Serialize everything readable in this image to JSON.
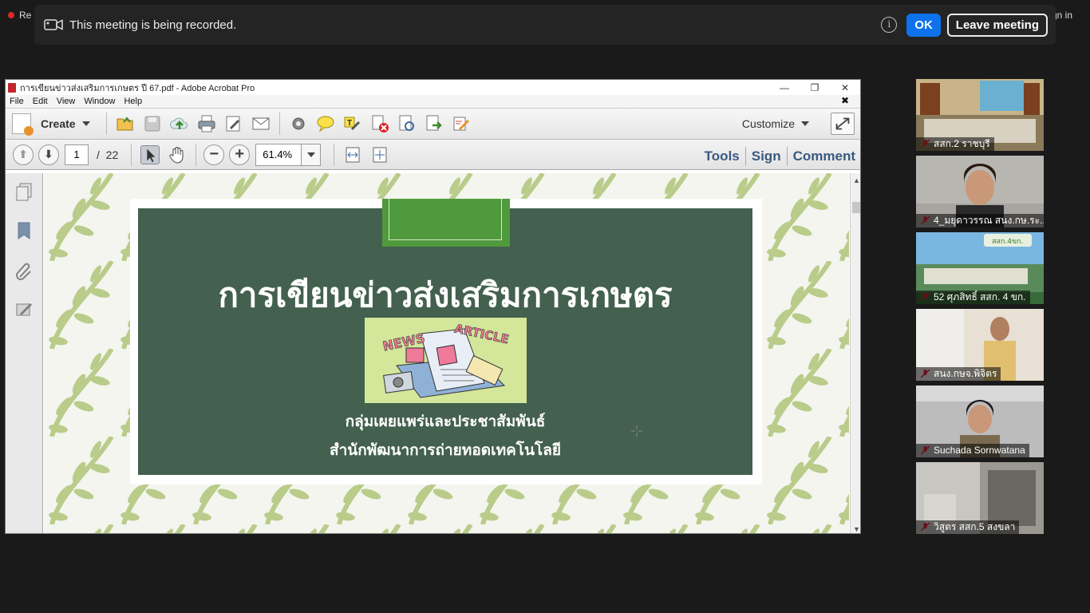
{
  "zoom": {
    "recording_indicator": "Re",
    "sign_in_partial": "gn in",
    "banner": {
      "message": "This meeting is being recorded.",
      "ok_label": "OK",
      "leave_label": "Leave meeting",
      "info_symbol": "i"
    }
  },
  "acrobat": {
    "window_title": "การเขียนข่าวส่งเสริมการเกษตร ปี 67.pdf - Adobe Acrobat Pro",
    "window_controls": {
      "minimize": "—",
      "restore": "❐",
      "close": "✕"
    },
    "menu": [
      "File",
      "Edit",
      "View",
      "Window",
      "Help"
    ],
    "menu_close": "✖",
    "toolbar": {
      "create_label": "Create",
      "customize_label": "Customize",
      "icons": [
        "open-folder-icon",
        "save-icon",
        "upload-cloud-icon",
        "print-icon",
        "edit-document-icon",
        "email-icon",
        "settings-gear-icon",
        "comment-bubble-icon",
        "highlight-text-icon",
        "delete-page-icon",
        "find-page-icon",
        "export-icon",
        "sign-pen-icon"
      ]
    },
    "nav": {
      "page_current": "1",
      "page_sep": "/",
      "page_total": "22",
      "zoom_value": "61.4%",
      "prev_symbol": "⬆",
      "next_symbol": "⬇",
      "zoom_out_symbol": "−",
      "zoom_in_symbol": "+"
    },
    "panels": {
      "tools": "Tools",
      "sign": "Sign",
      "comment": "Comment"
    }
  },
  "slide": {
    "title": "การเขียนข่าวส่งเสริมการเกษตร",
    "image_text_news": "NEWS",
    "image_text_article": "ARTICLE",
    "subtitle_1": "กลุ่มเผยแพร่และประชาสัมพันธ์",
    "subtitle_2": "สำนักพัฒนาการถ่ายทอดเทคโนโลยี",
    "colors": {
      "background": "#44604f",
      "accent": "#4f9a3c",
      "image_bg": "#d3e69a",
      "pattern_leaf": "#b9cc8a"
    }
  },
  "participants": [
    {
      "name": "สสก.2 ราชบุรี",
      "muted": true
    },
    {
      "name": "4_มยุดาวรรณ สนง.กษ.ระ...",
      "muted": true
    },
    {
      "name": "52 ศุภสิทธิ์ สสก. 4 ขก.",
      "muted": true
    },
    {
      "name": "สนง.กษจ.พิจิตร",
      "muted": true
    },
    {
      "name": "Suchada Sornwatana",
      "muted": true
    },
    {
      "name": "วิสูตร สสก.5 สงขลา",
      "muted": true
    }
  ]
}
